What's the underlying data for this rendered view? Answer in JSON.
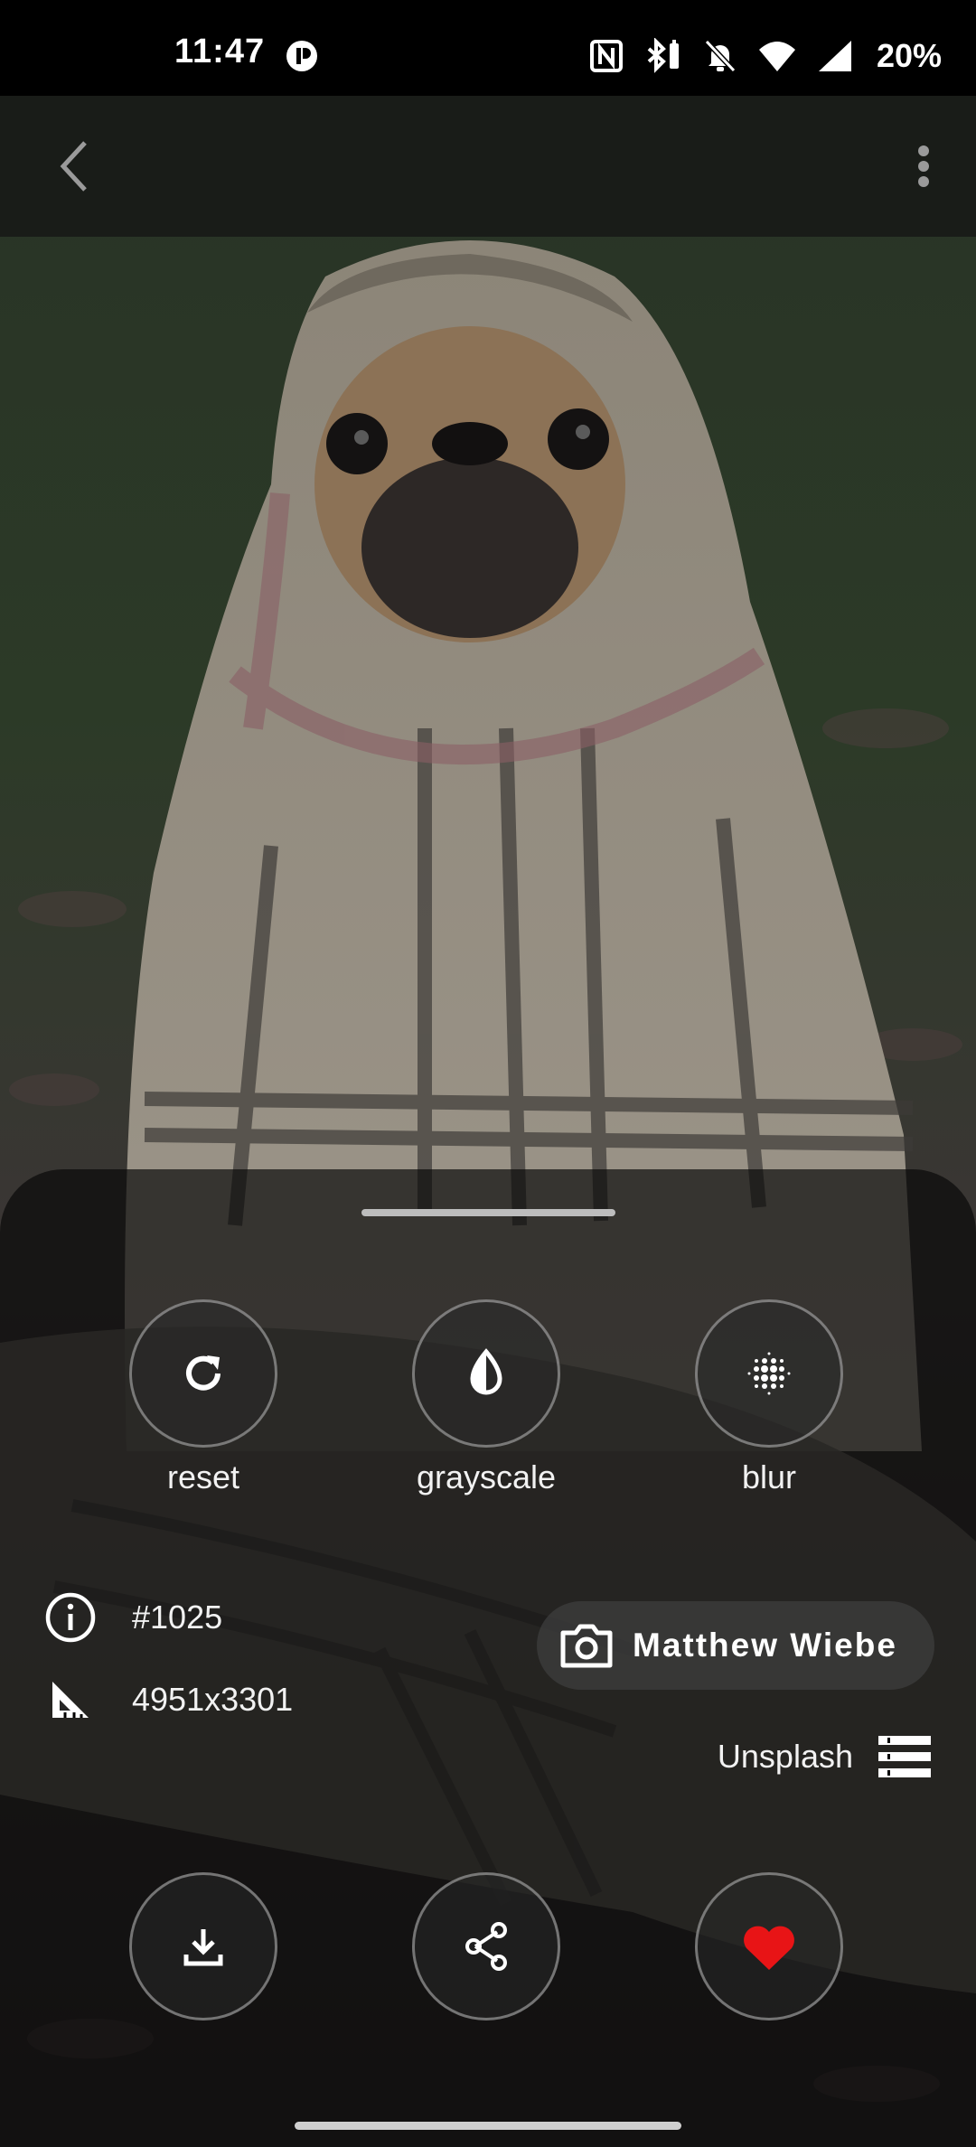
{
  "status_bar": {
    "time": "11:47",
    "battery": "20%",
    "icons": [
      "nfc-icon",
      "bluetooth-icon",
      "mute-bell-icon",
      "wifi-icon",
      "signal-icon",
      "battery-icon"
    ]
  },
  "app_bar": {
    "back_icon": "chevron-left-icon",
    "more_icon": "more-vert-icon"
  },
  "actions": {
    "reset_label": "reset",
    "grayscale_label": "grayscale",
    "blur_label": "blur"
  },
  "info": {
    "id": "#1025",
    "dimensions": "4951x3301"
  },
  "author": {
    "name": "Matthew Wiebe"
  },
  "source": {
    "label": "Unsplash"
  },
  "bottom_actions": {
    "download_icon": "download-icon",
    "share_icon": "share-icon",
    "favorite_icon": "heart-icon"
  },
  "colors": {
    "favorite": "#e81416",
    "sheet": "#080808",
    "text": "#f2f2f2"
  }
}
